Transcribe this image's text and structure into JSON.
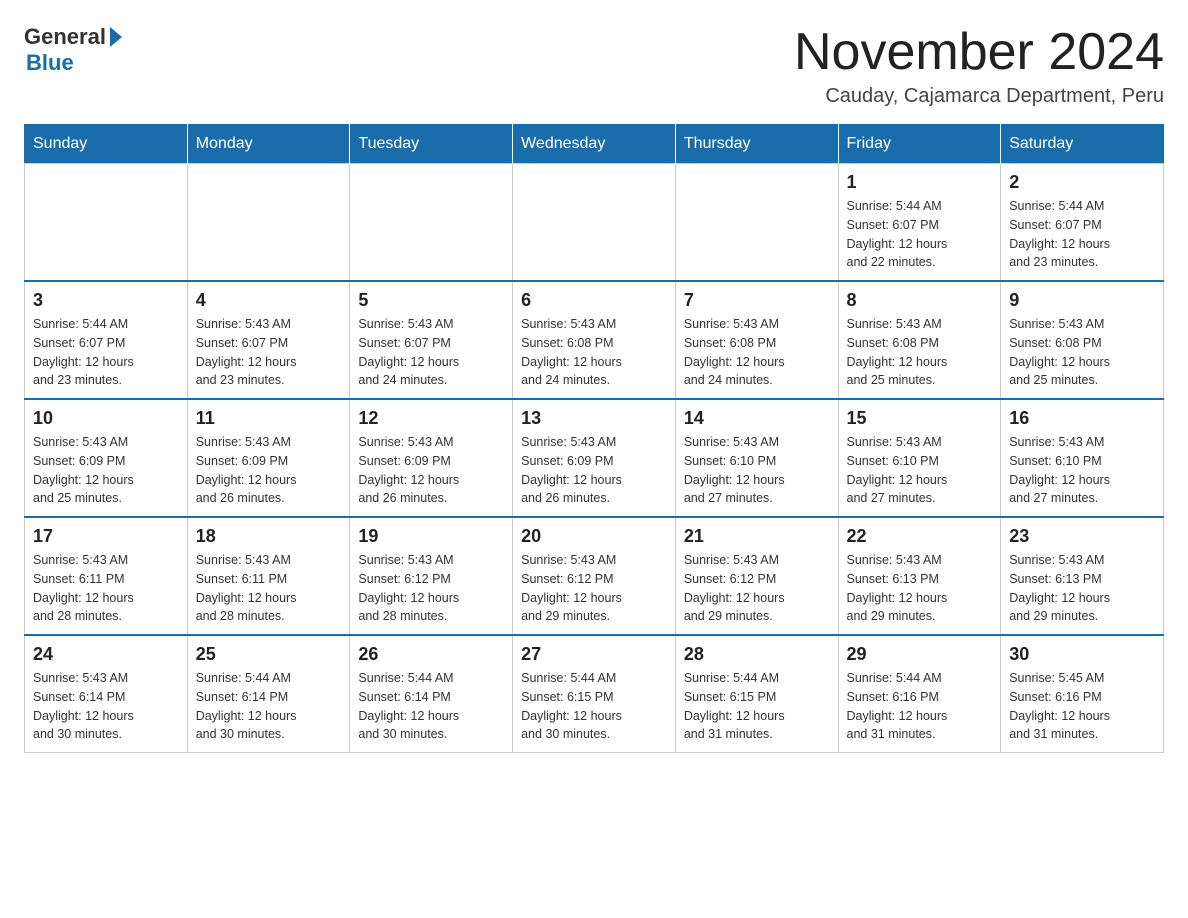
{
  "logo": {
    "general": "General",
    "blue": "Blue"
  },
  "header": {
    "title": "November 2024",
    "location": "Cauday, Cajamarca Department, Peru"
  },
  "weekdays": [
    "Sunday",
    "Monday",
    "Tuesday",
    "Wednesday",
    "Thursday",
    "Friday",
    "Saturday"
  ],
  "weeks": [
    [
      {
        "day": "",
        "info": ""
      },
      {
        "day": "",
        "info": ""
      },
      {
        "day": "",
        "info": ""
      },
      {
        "day": "",
        "info": ""
      },
      {
        "day": "",
        "info": ""
      },
      {
        "day": "1",
        "info": "Sunrise: 5:44 AM\nSunset: 6:07 PM\nDaylight: 12 hours\nand 22 minutes."
      },
      {
        "day": "2",
        "info": "Sunrise: 5:44 AM\nSunset: 6:07 PM\nDaylight: 12 hours\nand 23 minutes."
      }
    ],
    [
      {
        "day": "3",
        "info": "Sunrise: 5:44 AM\nSunset: 6:07 PM\nDaylight: 12 hours\nand 23 minutes."
      },
      {
        "day": "4",
        "info": "Sunrise: 5:43 AM\nSunset: 6:07 PM\nDaylight: 12 hours\nand 23 minutes."
      },
      {
        "day": "5",
        "info": "Sunrise: 5:43 AM\nSunset: 6:07 PM\nDaylight: 12 hours\nand 24 minutes."
      },
      {
        "day": "6",
        "info": "Sunrise: 5:43 AM\nSunset: 6:08 PM\nDaylight: 12 hours\nand 24 minutes."
      },
      {
        "day": "7",
        "info": "Sunrise: 5:43 AM\nSunset: 6:08 PM\nDaylight: 12 hours\nand 24 minutes."
      },
      {
        "day": "8",
        "info": "Sunrise: 5:43 AM\nSunset: 6:08 PM\nDaylight: 12 hours\nand 25 minutes."
      },
      {
        "day": "9",
        "info": "Sunrise: 5:43 AM\nSunset: 6:08 PM\nDaylight: 12 hours\nand 25 minutes."
      }
    ],
    [
      {
        "day": "10",
        "info": "Sunrise: 5:43 AM\nSunset: 6:09 PM\nDaylight: 12 hours\nand 25 minutes."
      },
      {
        "day": "11",
        "info": "Sunrise: 5:43 AM\nSunset: 6:09 PM\nDaylight: 12 hours\nand 26 minutes."
      },
      {
        "day": "12",
        "info": "Sunrise: 5:43 AM\nSunset: 6:09 PM\nDaylight: 12 hours\nand 26 minutes."
      },
      {
        "day": "13",
        "info": "Sunrise: 5:43 AM\nSunset: 6:09 PM\nDaylight: 12 hours\nand 26 minutes."
      },
      {
        "day": "14",
        "info": "Sunrise: 5:43 AM\nSunset: 6:10 PM\nDaylight: 12 hours\nand 27 minutes."
      },
      {
        "day": "15",
        "info": "Sunrise: 5:43 AM\nSunset: 6:10 PM\nDaylight: 12 hours\nand 27 minutes."
      },
      {
        "day": "16",
        "info": "Sunrise: 5:43 AM\nSunset: 6:10 PM\nDaylight: 12 hours\nand 27 minutes."
      }
    ],
    [
      {
        "day": "17",
        "info": "Sunrise: 5:43 AM\nSunset: 6:11 PM\nDaylight: 12 hours\nand 28 minutes."
      },
      {
        "day": "18",
        "info": "Sunrise: 5:43 AM\nSunset: 6:11 PM\nDaylight: 12 hours\nand 28 minutes."
      },
      {
        "day": "19",
        "info": "Sunrise: 5:43 AM\nSunset: 6:12 PM\nDaylight: 12 hours\nand 28 minutes."
      },
      {
        "day": "20",
        "info": "Sunrise: 5:43 AM\nSunset: 6:12 PM\nDaylight: 12 hours\nand 29 minutes."
      },
      {
        "day": "21",
        "info": "Sunrise: 5:43 AM\nSunset: 6:12 PM\nDaylight: 12 hours\nand 29 minutes."
      },
      {
        "day": "22",
        "info": "Sunrise: 5:43 AM\nSunset: 6:13 PM\nDaylight: 12 hours\nand 29 minutes."
      },
      {
        "day": "23",
        "info": "Sunrise: 5:43 AM\nSunset: 6:13 PM\nDaylight: 12 hours\nand 29 minutes."
      }
    ],
    [
      {
        "day": "24",
        "info": "Sunrise: 5:43 AM\nSunset: 6:14 PM\nDaylight: 12 hours\nand 30 minutes."
      },
      {
        "day": "25",
        "info": "Sunrise: 5:44 AM\nSunset: 6:14 PM\nDaylight: 12 hours\nand 30 minutes."
      },
      {
        "day": "26",
        "info": "Sunrise: 5:44 AM\nSunset: 6:14 PM\nDaylight: 12 hours\nand 30 minutes."
      },
      {
        "day": "27",
        "info": "Sunrise: 5:44 AM\nSunset: 6:15 PM\nDaylight: 12 hours\nand 30 minutes."
      },
      {
        "day": "28",
        "info": "Sunrise: 5:44 AM\nSunset: 6:15 PM\nDaylight: 12 hours\nand 31 minutes."
      },
      {
        "day": "29",
        "info": "Sunrise: 5:44 AM\nSunset: 6:16 PM\nDaylight: 12 hours\nand 31 minutes."
      },
      {
        "day": "30",
        "info": "Sunrise: 5:45 AM\nSunset: 6:16 PM\nDaylight: 12 hours\nand 31 minutes."
      }
    ]
  ]
}
